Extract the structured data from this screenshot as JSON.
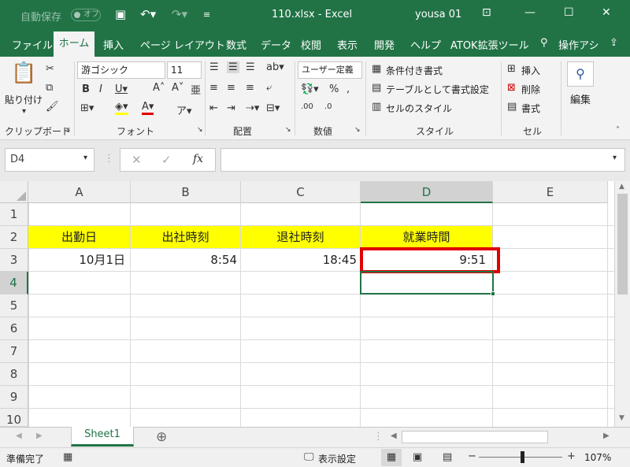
{
  "titlebar": {
    "autosave_label": "自動保存",
    "autosave_state": "オフ",
    "file_title": "110.xlsx  -  Excel",
    "user": "yousa 01"
  },
  "menu": {
    "tabs": [
      "ファイル",
      "ホーム",
      "挿入",
      "ページ レイアウト",
      "数式",
      "データ",
      "校閲",
      "表示",
      "開発",
      "ヘルプ",
      "ATOK拡張ツール"
    ],
    "search": "操作アシ"
  },
  "ribbon": {
    "clipboard": {
      "paste": "貼り付け",
      "label": "クリップボード"
    },
    "font": {
      "name": "游ゴシック",
      "size": "11",
      "label": "フォント"
    },
    "alignment": {
      "label": "配置"
    },
    "number": {
      "format": "ユーザー定義",
      "label": "数値"
    },
    "styles": {
      "conditional": "条件付き書式",
      "table": "テーブルとして書式設定",
      "cell_styles": "セルのスタイル",
      "label": "スタイル"
    },
    "cells": {
      "insert": "挿入",
      "delete": "削除",
      "format": "書式",
      "label": "セル"
    },
    "editing": {
      "label": "編集"
    }
  },
  "formula_bar": {
    "name_box": "D4",
    "fx": "fx",
    "content": ""
  },
  "sheet": {
    "columns": [
      "A",
      "B",
      "C",
      "D",
      "E"
    ],
    "rows": [
      "1",
      "2",
      "3",
      "4",
      "5",
      "6",
      "7",
      "8",
      "9",
      "10"
    ],
    "headers": [
      "出勤日",
      "出社時刻",
      "退社時刻",
      "就業時間"
    ],
    "data_row": [
      "10月1日",
      "8:54",
      "18:45",
      "9:51"
    ],
    "header_fill": "#ffff00",
    "highlight_color": "#e00000",
    "selection_color": "#217346"
  },
  "sheet_tabs": {
    "active": "Sheet1"
  },
  "status": {
    "ready": "準備完了",
    "display_settings": "表示設定",
    "zoom": "107%"
  }
}
